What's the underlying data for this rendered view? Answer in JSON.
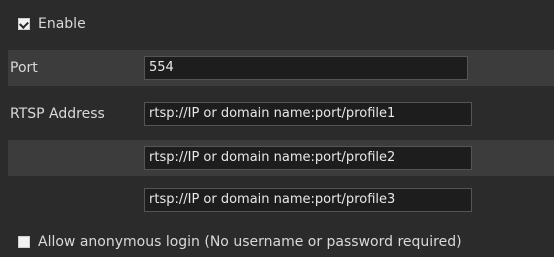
{
  "enable": {
    "label": "Enable",
    "checked": true
  },
  "port": {
    "label": "Port",
    "value": "554"
  },
  "rtsp": {
    "label": "RTSP Address",
    "addresses": [
      "rtsp://IP or domain name:port/profile1",
      "rtsp://IP or domain name:port/profile2",
      "rtsp://IP or domain name:port/profile3"
    ]
  },
  "anonymous": {
    "label": "Allow anonymous login (No username or password required)",
    "checked": false
  }
}
